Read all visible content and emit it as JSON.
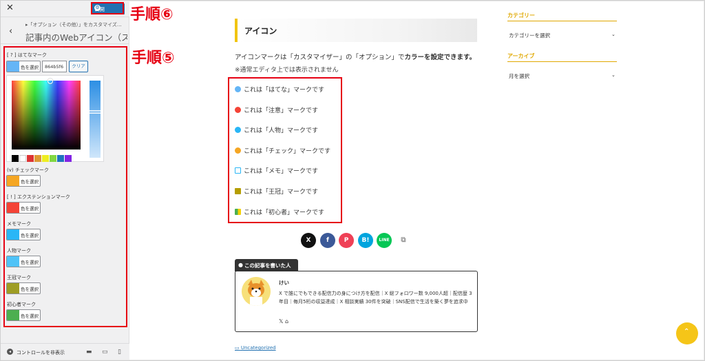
{
  "annotations": {
    "step6": "手順⑥",
    "step5": "手順⑤"
  },
  "customizer": {
    "close_icon": "close-icon",
    "publish_label": "公開",
    "back_icon": "chevron-left-icon",
    "breadcrumb": "▸「オプション（その他）」をカスタマイズ…",
    "page_title": "記事内のWebアイコン（ス…",
    "hex_value": "864b5f6",
    "clear_label": "クリア",
    "choose_color": "色を選択",
    "sections": [
      {
        "label": "[ ? ] はてなマーク",
        "color": "#64b5f6"
      },
      {
        "label": "(v) チェックマーク",
        "color": "#f5a623"
      },
      {
        "label": "[ ! ] エクステンションマーク",
        "color": "#f44336"
      },
      {
        "label": "メモマーク",
        "color": "#29b6f6"
      },
      {
        "label": "人物マーク",
        "color": "#4fc3f7"
      },
      {
        "label": "王冠マーク",
        "color": "#9e9d24"
      },
      {
        "label": "初心者マーク",
        "color": "#4caf50"
      }
    ],
    "palette": [
      "#000000",
      "#ffffff",
      "#dd3333",
      "#dd9933",
      "#eeee22",
      "#81d742",
      "#1e73be",
      "#8224e3"
    ],
    "hide_controls": "コントロールを非表示"
  },
  "main": {
    "heading": "アイコン",
    "para_part1": "アイコンマークは「カスタマイザー」の「オプション」で",
    "para_bold": "カラーを設定できます。",
    "para2": "※通常エディタ上では表示されません",
    "icon_rows": [
      {
        "text": "これは「はてな」マークです",
        "color": "#64b5f6"
      },
      {
        "text": "これは「注意」マークです",
        "color": "#f44336"
      },
      {
        "text": "これは「人物」マークです",
        "color": "#29b6f6"
      },
      {
        "text": "これは「チェック」マークです",
        "color": "#f5a623"
      },
      {
        "text": "これは「メモ」マークです",
        "color": "#29b6f6"
      },
      {
        "text": "これは「王冠」マークです",
        "color": "#b59d00"
      },
      {
        "text": "これは「初心者」マークです",
        "color": "#4caf50"
      }
    ],
    "social": {
      "x": "X",
      "facebook": "f",
      "pocket": "P",
      "hatena": "B!",
      "line": "LINE",
      "copy": "copy-icon"
    },
    "author_tab": "この記事を書いた人",
    "author_name": "けい",
    "author_desc": "X で誰にでもできる配信力の身につけ方を配信｜X 総フォロワー数 9,000人超｜配信歴 3年目｜毎月5桁の収益達成｜X 相談実績 30件を突破｜SNS配信で生活を築く夢を追求中",
    "category": "Uncategorized"
  },
  "widgets": {
    "category_title": "カテゴリー",
    "category_select": "カテゴリーを選択",
    "archive_title": "アーカイブ",
    "archive_select": "月を選択"
  }
}
